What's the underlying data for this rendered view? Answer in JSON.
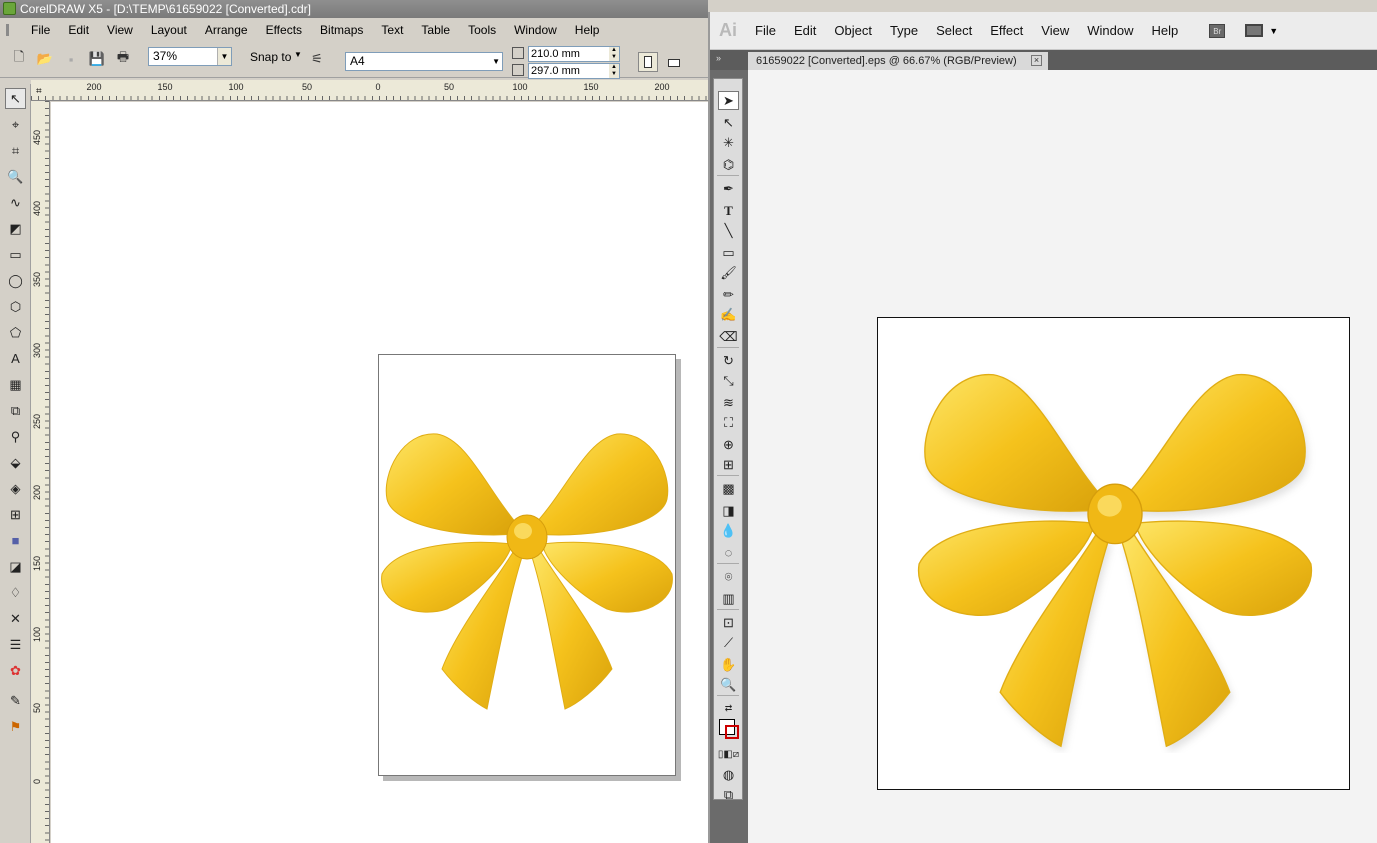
{
  "corel": {
    "title": "CorelDRAW X5 - [D:\\TEMP\\61659022 [Converted].cdr]",
    "menu": [
      "File",
      "Edit",
      "View",
      "Layout",
      "Arrange",
      "Effects",
      "Bitmaps",
      "Text",
      "Table",
      "Tools",
      "Window",
      "Help"
    ],
    "zoom": "37%",
    "snap_label": "Snap to",
    "page_size": "A4",
    "width": "210.0 mm",
    "height": "297.0 mm",
    "ruler_h": [
      "200",
      "150",
      "100",
      "50",
      "0",
      "50",
      "100",
      "150",
      "200"
    ],
    "ruler_v": [
      "450",
      "400",
      "350",
      "300",
      "250",
      "200",
      "150",
      "100",
      "50",
      "0"
    ]
  },
  "illustrator": {
    "logo": "Ai",
    "menu": [
      "File",
      "Edit",
      "Object",
      "Type",
      "Select",
      "Effect",
      "View",
      "Window",
      "Help"
    ],
    "bridge_label": "Br",
    "doc_tab": "61659022 [Converted].eps @ 66.67% (RGB/Preview)",
    "close_glyph": "×"
  },
  "colors": {
    "bow_light": "#fde566",
    "bow_mid": "#f5c21c",
    "bow_dark": "#d9a20b"
  }
}
